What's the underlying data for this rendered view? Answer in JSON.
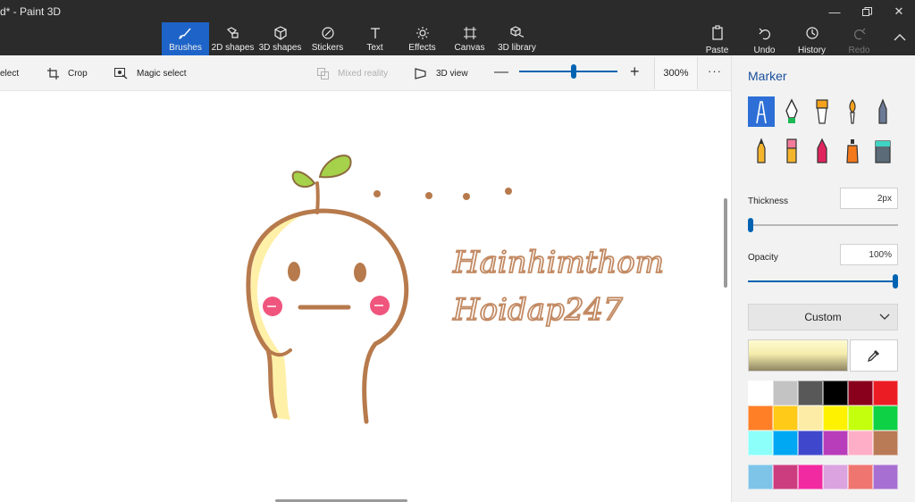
{
  "window": {
    "title": "d* - Paint 3D",
    "controls": [
      "minimize",
      "maximize",
      "close"
    ]
  },
  "ribbon": {
    "tools": [
      {
        "label": "Brushes",
        "icon": "brush-icon",
        "active": true
      },
      {
        "label": "2D shapes",
        "icon": "2d-shapes-icon",
        "active": false
      },
      {
        "label": "3D shapes",
        "icon": "3d-shapes-icon",
        "active": false
      },
      {
        "label": "Stickers",
        "icon": "stickers-icon",
        "active": false
      },
      {
        "label": "Text",
        "icon": "text-icon",
        "active": false
      },
      {
        "label": "Effects",
        "icon": "effects-icon",
        "active": false
      },
      {
        "label": "Canvas",
        "icon": "canvas-icon",
        "active": false
      },
      {
        "label": "3D library",
        "icon": "3d-library-icon",
        "active": false
      }
    ],
    "actions": [
      {
        "label": "Paste",
        "icon": "paste-icon",
        "enabled": true
      },
      {
        "label": "Undo",
        "icon": "undo-icon",
        "enabled": true
      },
      {
        "label": "History",
        "icon": "history-icon",
        "enabled": true
      },
      {
        "label": "Redo",
        "icon": "redo-icon",
        "enabled": false
      }
    ]
  },
  "toolbar": {
    "select_label": "elect",
    "crop_label": "Crop",
    "magic_select_label": "Magic select",
    "mixed_reality_label": "Mixed reality",
    "view3d_label": "3D view",
    "zoom_value": "300%",
    "zoom_fraction": 0.55
  },
  "canvas": {
    "text_line1": "Hainhimthom",
    "text_line2": "Hoidap247"
  },
  "panel": {
    "title": "Marker",
    "brushes": [
      {
        "name": "marker-brush",
        "selected": true
      },
      {
        "name": "calligraphy-pen-brush",
        "selected": false
      },
      {
        "name": "oil-brush",
        "selected": false
      },
      {
        "name": "watercolor-brush",
        "selected": false
      },
      {
        "name": "pixel-pen-brush",
        "selected": false
      },
      {
        "name": "pencil-brush",
        "selected": false
      },
      {
        "name": "eraser-brush",
        "selected": false
      },
      {
        "name": "crayon-brush",
        "selected": false
      },
      {
        "name": "spray-can-brush",
        "selected": false
      },
      {
        "name": "fill-bucket-brush",
        "selected": false
      }
    ],
    "thickness_label": "Thickness",
    "thickness_value": "2px",
    "thickness_fraction": 0.02,
    "opacity_label": "Opacity",
    "opacity_value": "100%",
    "opacity_fraction": 1.0,
    "color_mode": "Custom",
    "current_color": "#f4ecac",
    "palette": [
      "#ffffff",
      "#c3c3c3",
      "#585858",
      "#000000",
      "#88001b",
      "#ec1c24",
      "#ff7f27",
      "#ffca18",
      "#fdeca6",
      "#fff200",
      "#c4ff0e",
      "#0ed145",
      "#8cfffb",
      "#00a8f3",
      "#3f48cc",
      "#b83dba",
      "#ffaec8",
      "#b97a56"
    ],
    "palette_extra": [
      "#7ec3e8",
      "#cc3d7f",
      "#f22aa1",
      "#dba3e0",
      "#ef7571",
      "#a76fd1"
    ]
  }
}
